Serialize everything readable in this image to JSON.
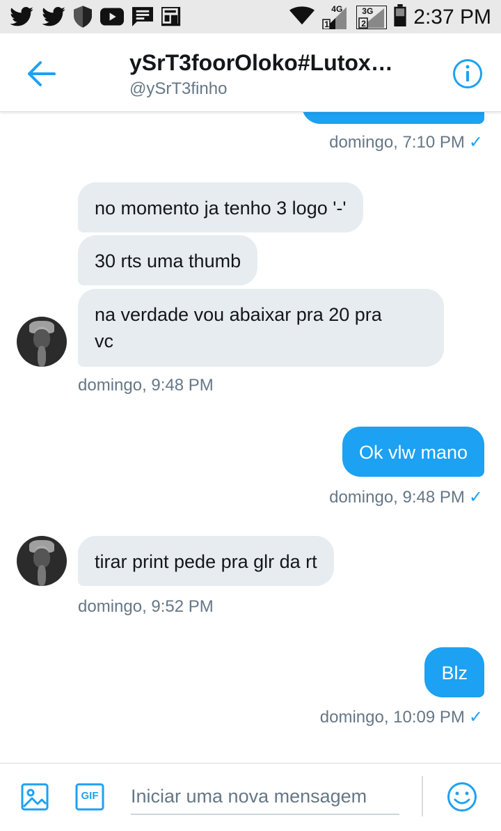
{
  "status_bar": {
    "time": "2:37 PM",
    "network_a": "4G",
    "network_b": "3G",
    "sim_a": "1",
    "sim_b": "2"
  },
  "header": {
    "title": "ySrT3foorOloko#Lutox…",
    "handle": "@ySrT3finho"
  },
  "messages": [
    {
      "kind": "timestamp-out",
      "text": "domingo, 7:10 PM",
      "read": "✓"
    },
    {
      "kind": "in",
      "text": "no momento ja tenho 3 logo '-'"
    },
    {
      "kind": "in",
      "text": "30 rts uma thumb"
    },
    {
      "kind": "in",
      "text_line1": "na verdade vou abaixar pra 20 pra",
      "text_line2": "vc"
    },
    {
      "kind": "timestamp-in",
      "text": "domingo, 9:48 PM"
    },
    {
      "kind": "out",
      "text": "Ok vlw mano"
    },
    {
      "kind": "timestamp-out",
      "text": "domingo, 9:48 PM",
      "read": "✓"
    },
    {
      "kind": "in",
      "text": "tirar print pede pra glr da rt"
    },
    {
      "kind": "timestamp-in",
      "text": "domingo, 9:52 PM"
    },
    {
      "kind": "out",
      "text": "Blz"
    },
    {
      "kind": "timestamp-out",
      "text": "domingo, 10:09 PM",
      "read": "✓"
    }
  ],
  "composer": {
    "placeholder": "Iniciar uma nova mensagem",
    "gif_label": "GIF"
  },
  "colors": {
    "accent": "#1da1f2",
    "incoming_bubble": "#e6ecf0",
    "secondary_text": "#657786",
    "status_bar_bg": "#e9e9e9"
  }
}
